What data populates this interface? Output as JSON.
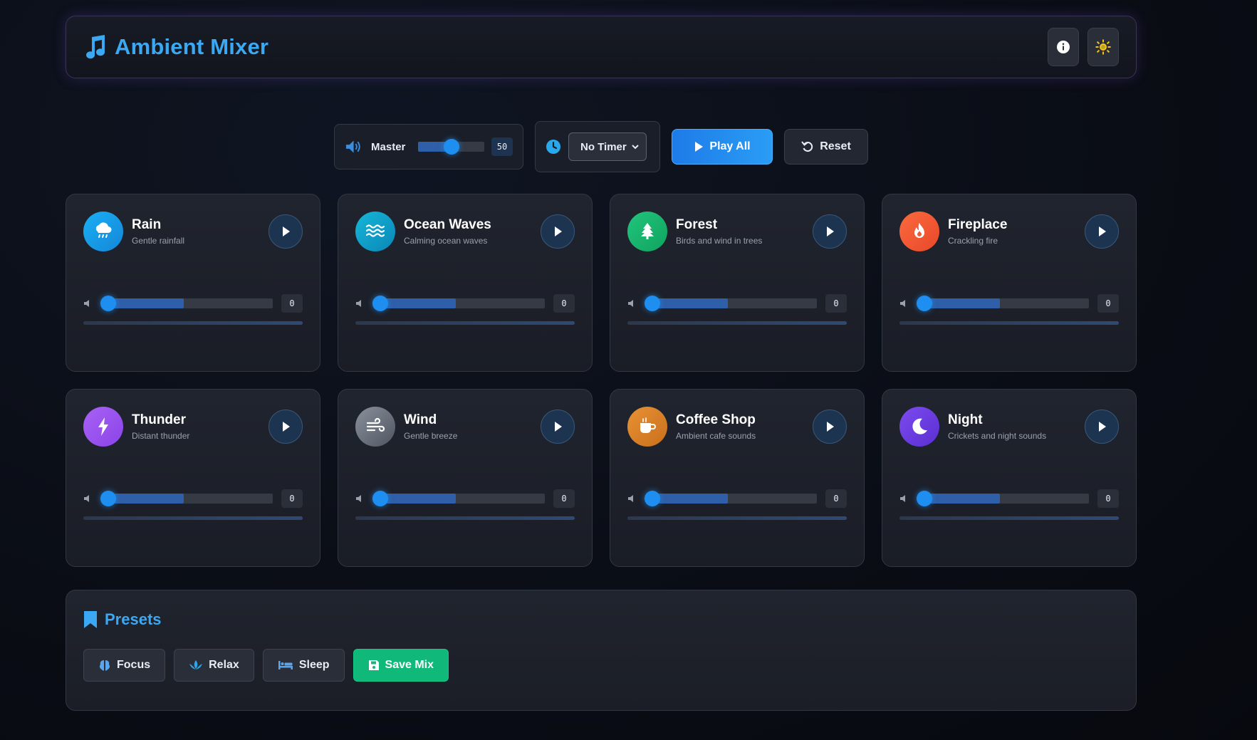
{
  "app": {
    "title": "Ambient Mixer"
  },
  "header": {
    "info_icon": "info-icon",
    "theme_icon": "sun-icon",
    "accent": "#3aa8f2"
  },
  "master": {
    "label": "Master",
    "value": "50",
    "level": 0.5,
    "icon": "speaker-icon"
  },
  "timer": {
    "selected": "No Timer",
    "icon": "clock-icon"
  },
  "actions": {
    "play_all": "Play All",
    "reset": "Reset"
  },
  "sounds": [
    {
      "name": "Rain",
      "description": "Gentle rainfall",
      "volume": "0",
      "icon": "rain-cloud-icon",
      "color": "#1ea5ee"
    },
    {
      "name": "Ocean Waves",
      "description": "Calming ocean waves",
      "volume": "0",
      "icon": "water-waves-icon",
      "color": "#0ea0c8"
    },
    {
      "name": "Forest",
      "description": "Birds and wind in trees",
      "volume": "0",
      "icon": "tree-icon",
      "color": "#18b56e"
    },
    {
      "name": "Fireplace",
      "description": "Crackling fire",
      "volume": "0",
      "icon": "fire-icon",
      "color": "#f05a35"
    },
    {
      "name": "Thunder",
      "description": "Distant thunder",
      "volume": "0",
      "icon": "lightning-icon",
      "color": "#9a55f0"
    },
    {
      "name": "Wind",
      "description": "Gentle breeze",
      "volume": "0",
      "icon": "wind-icon",
      "color": "#6b7280"
    },
    {
      "name": "Coffee Shop",
      "description": "Ambient cafe sounds",
      "volume": "0",
      "icon": "coffee-cup-icon",
      "color": "#d8802a"
    },
    {
      "name": "Night",
      "description": "Crickets and night sounds",
      "volume": "0",
      "icon": "moon-icon",
      "color": "#6e3fe0"
    }
  ],
  "presets": {
    "title": "Presets",
    "items": [
      {
        "label": "Focus",
        "icon": "brain-icon"
      },
      {
        "label": "Relax",
        "icon": "lotus-icon"
      },
      {
        "label": "Sleep",
        "icon": "bed-icon"
      }
    ],
    "save": {
      "label": "Save Mix",
      "icon": "floppy-disk-icon",
      "color": "#10b87a"
    }
  }
}
